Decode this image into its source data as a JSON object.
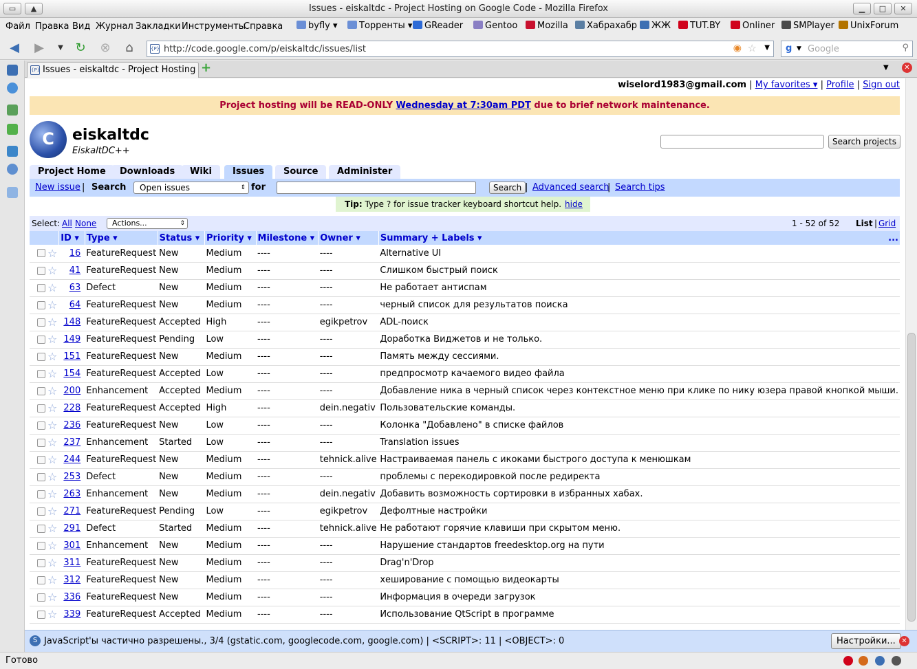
{
  "window": {
    "title": "Issues - eiskaltdc - Project Hosting on Google Code - Mozilla Firefox"
  },
  "menu": [
    "Файл",
    "Правка",
    "Вид",
    "Журнал",
    "Закладки",
    "Инструменты",
    "Справка"
  ],
  "bookmarks": [
    {
      "label": "byfly ▾",
      "icon": "folder-icon",
      "color": "#6b8fd6"
    },
    {
      "label": "Торренты ▾",
      "icon": "folder-icon",
      "color": "#6b8fd6"
    },
    {
      "label": "GReader",
      "icon": "greader-icon",
      "color": "#2d6ad6"
    },
    {
      "label": "Gentoo",
      "icon": "gentoo-icon",
      "color": "#8a7fc4"
    },
    {
      "label": "Mozilla",
      "icon": "mozilla-icon",
      "color": "#c8102e"
    },
    {
      "label": "Хабрахабр",
      "icon": "habr-icon",
      "color": "#5b7fa3"
    },
    {
      "label": "ЖЖ",
      "icon": "lj-icon",
      "color": "#3c6fb3"
    },
    {
      "label": "TUT.BY",
      "icon": "tutby-icon",
      "color": "#d0021b"
    },
    {
      "label": "Onliner",
      "icon": "onliner-icon",
      "color": "#d0021b"
    },
    {
      "label": "SMPlayer",
      "icon": "smplayer-icon",
      "color": "#4a4a4a"
    },
    {
      "label": "UnixForum",
      "icon": "unixforum-icon",
      "color": "#b37400"
    }
  ],
  "nav": {
    "url": "http://code.google.com/p/eiskaltdc/issues/list",
    "search_placeholder": "Google",
    "favicon_text": "{P}"
  },
  "tabs": [
    {
      "label": "Issues - eiskaltdc - Project Hosting o..."
    }
  ],
  "user": {
    "email": "wiselord1983@gmail.com",
    "my_favorites": "My favorites ▾",
    "profile": "Profile",
    "signout": "Sign out",
    "sep": "|"
  },
  "banner": {
    "before": "Project hosting will be READ-ONLY ",
    "link": "Wednesday at 7:30am PDT",
    "after": " due to brief network maintenance."
  },
  "project": {
    "name": "eiskaltdc",
    "summary": "EiskaltDC++",
    "search_button": "Search projects",
    "logo_text": "C"
  },
  "project_tabs": [
    "Project Home",
    "Downloads",
    "Wiki",
    "Issues",
    "Source",
    "Administer"
  ],
  "subbar": {
    "new_issue": "New issue",
    "search": "Search",
    "status_select": "Open issues",
    "for": "for",
    "search_button": "Search",
    "advanced": "Advanced search",
    "tips": "Search tips",
    "sep": "|"
  },
  "tip": {
    "label": "Tip:",
    "text": " Type ? for issue tracker keyboard shortcut help.",
    "hide": "hide"
  },
  "list": {
    "select_label": "Select:",
    "all": "All",
    "none": "None",
    "actions": "Actions...",
    "range": "1 - 52 of 52",
    "view_list": "List",
    "view_grid": "Grid",
    "sep": "|",
    "more": "..."
  },
  "columns": [
    "ID ▾",
    "Type ▾",
    "Status ▾",
    "Priority ▾",
    "Milestone ▾",
    "Owner ▾",
    "Summary + Labels ▾"
  ],
  "issues": [
    {
      "id": "16",
      "type": "FeatureRequest",
      "status": "New",
      "priority": "Medium",
      "milestone": "----",
      "owner": "----",
      "summary": "Alternative UI"
    },
    {
      "id": "41",
      "type": "FeatureRequest",
      "status": "New",
      "priority": "Medium",
      "milestone": "----",
      "owner": "----",
      "summary": "Слишком быстрый поиск"
    },
    {
      "id": "63",
      "type": "Defect",
      "status": "New",
      "priority": "Medium",
      "milestone": "----",
      "owner": "----",
      "summary": "Не работает антиспам"
    },
    {
      "id": "64",
      "type": "FeatureRequest",
      "status": "New",
      "priority": "Medium",
      "milestone": "----",
      "owner": "----",
      "summary": "черный список для результатов поиска"
    },
    {
      "id": "148",
      "type": "FeatureRequest",
      "status": "Accepted",
      "priority": "High",
      "milestone": "----",
      "owner": "egikpetrov",
      "summary": "ADL-поиск"
    },
    {
      "id": "149",
      "type": "FeatureRequest",
      "status": "Pending",
      "priority": "Low",
      "milestone": "----",
      "owner": "----",
      "summary": "Доработка Виджетов и не только."
    },
    {
      "id": "151",
      "type": "FeatureRequest",
      "status": "New",
      "priority": "Medium",
      "milestone": "----",
      "owner": "----",
      "summary": "Память между сессиями."
    },
    {
      "id": "154",
      "type": "FeatureRequest",
      "status": "Accepted",
      "priority": "Low",
      "milestone": "----",
      "owner": "----",
      "summary": "предпросмотр качаемого видео файла"
    },
    {
      "id": "200",
      "type": "Enhancement",
      "status": "Accepted",
      "priority": "Medium",
      "milestone": "----",
      "owner": "----",
      "summary": "Добавление ника в черный список через контекстное меню при клике по нику юзера правой кнопкой мыши."
    },
    {
      "id": "228",
      "type": "FeatureRequest",
      "status": "Accepted",
      "priority": "High",
      "milestone": "----",
      "owner": "dein.negativ",
      "summary": "Пользовательские команды."
    },
    {
      "id": "236",
      "type": "FeatureRequest",
      "status": "New",
      "priority": "Low",
      "milestone": "----",
      "owner": "----",
      "summary": "Колонка \"Добавлено\" в списке файлов"
    },
    {
      "id": "237",
      "type": "Enhancement",
      "status": "Started",
      "priority": "Low",
      "milestone": "----",
      "owner": "----",
      "summary": "Translation issues"
    },
    {
      "id": "244",
      "type": "FeatureRequest",
      "status": "New",
      "priority": "Medium",
      "milestone": "----",
      "owner": "tehnick.alive",
      "summary": "Настраиваемая панель с икоками быстрого доступа к менюшкам"
    },
    {
      "id": "253",
      "type": "Defect",
      "status": "New",
      "priority": "Medium",
      "milestone": "----",
      "owner": "----",
      "summary": "проблемы с перекодировкой после редиректа"
    },
    {
      "id": "263",
      "type": "Enhancement",
      "status": "New",
      "priority": "Medium",
      "milestone": "----",
      "owner": "dein.negativ",
      "summary": "Добавить возможность сортировки в избранных хабах."
    },
    {
      "id": "271",
      "type": "FeatureRequest",
      "status": "Pending",
      "priority": "Low",
      "milestone": "----",
      "owner": "egikpetrov",
      "summary": "Дефолтные настройки"
    },
    {
      "id": "291",
      "type": "Defect",
      "status": "Started",
      "priority": "Medium",
      "milestone": "----",
      "owner": "tehnick.alive",
      "summary": "Не работают горячие клавиши при скрытом меню."
    },
    {
      "id": "301",
      "type": "Enhancement",
      "status": "New",
      "priority": "Medium",
      "milestone": "----",
      "owner": "----",
      "summary": "Нарушение стандартов freedesktop.org на пути"
    },
    {
      "id": "311",
      "type": "FeatureRequest",
      "status": "New",
      "priority": "Medium",
      "milestone": "----",
      "owner": "----",
      "summary": "Drag'n'Drop"
    },
    {
      "id": "312",
      "type": "FeatureRequest",
      "status": "New",
      "priority": "Medium",
      "milestone": "----",
      "owner": "----",
      "summary": "хеширование с помощью видеокарты"
    },
    {
      "id": "336",
      "type": "FeatureRequest",
      "status": "New",
      "priority": "Medium",
      "milestone": "----",
      "owner": "----",
      "summary": "Информация в очереди загрузок"
    },
    {
      "id": "339",
      "type": "FeatureRequest",
      "status": "Accepted",
      "priority": "Medium",
      "milestone": "----",
      "owner": "----",
      "summary": "Использование QtScript в программе"
    }
  ],
  "notification": {
    "text": "JavaScript'ы частично разрешены., 3/4 (gstatic.com, googlecode.com, google.com) | <SCRIPT>: 11 | <OBJECT>: 0",
    "button": "Настройки..."
  },
  "statusbar": {
    "text": "Готово"
  }
}
